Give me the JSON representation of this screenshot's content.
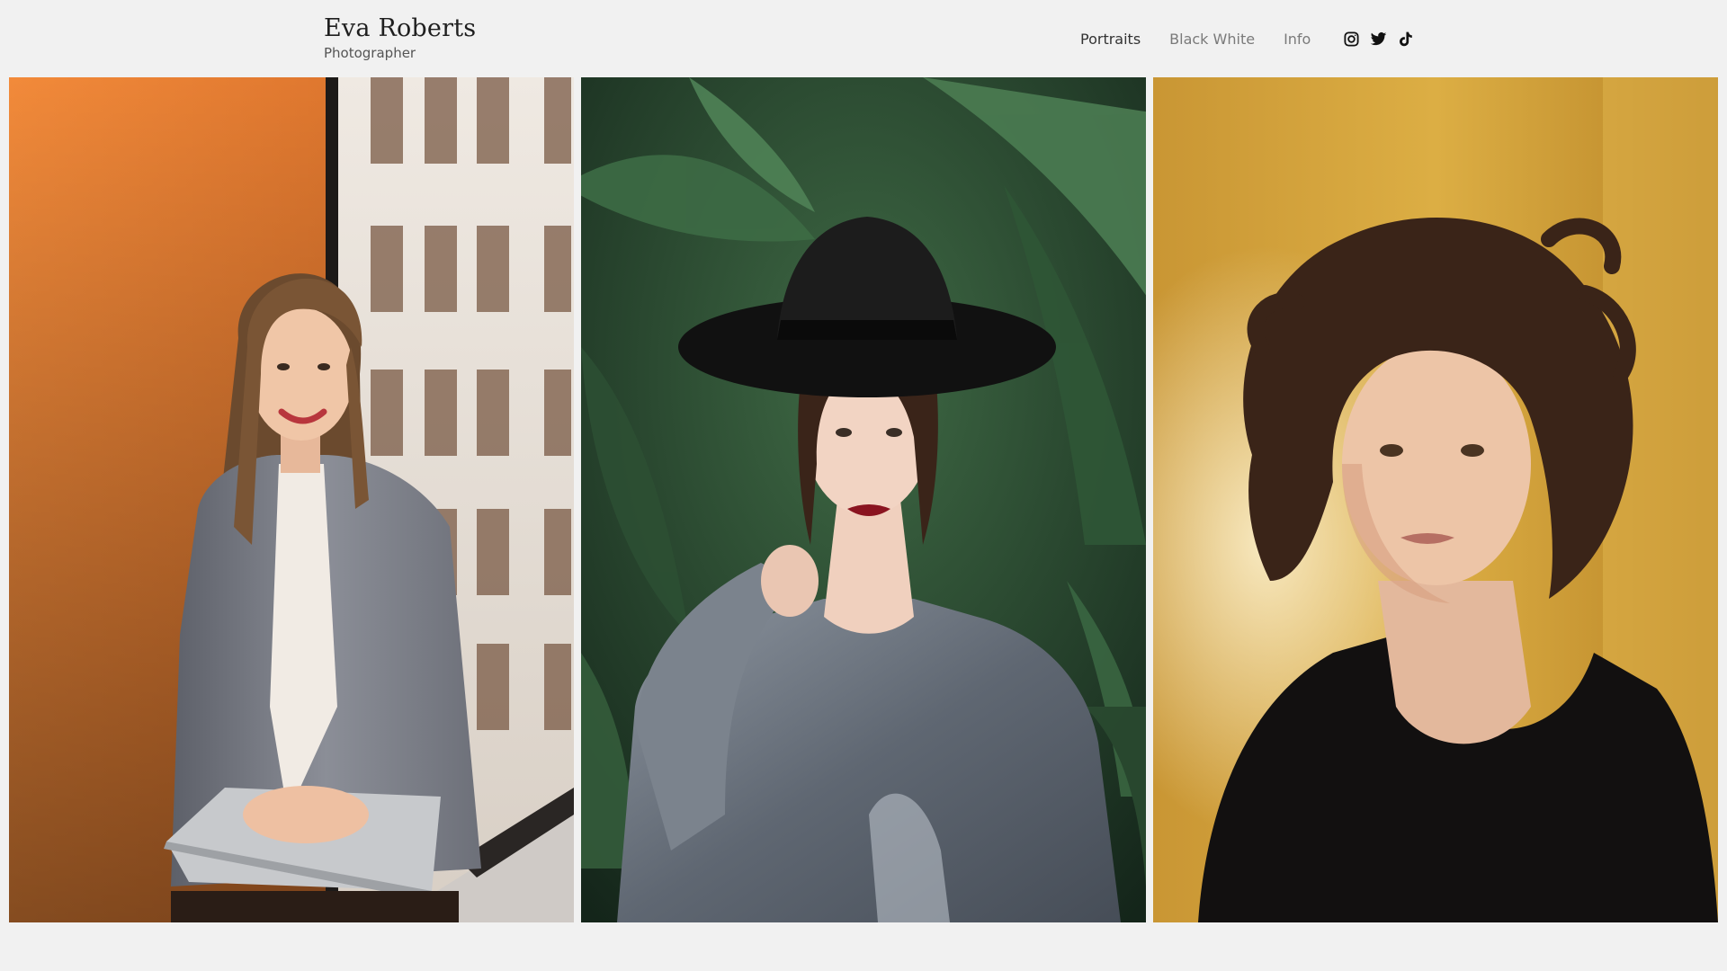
{
  "brand": {
    "name": "Eva Roberts",
    "subtitle": "Photographer"
  },
  "nav": {
    "items": [
      {
        "label": "Portraits",
        "active": true
      },
      {
        "label": "Black White",
        "active": false
      },
      {
        "label": "Info",
        "active": false
      }
    ],
    "social": [
      {
        "icon": "instagram-icon"
      },
      {
        "icon": "twitter-icon"
      },
      {
        "icon": "tiktok-icon"
      }
    ]
  },
  "gallery": {
    "photos": [
      {
        "subject": "portrait-woman-grey-blazer",
        "background_color": "#e0782f"
      },
      {
        "subject": "portrait-woman-black-hat",
        "background_color": "#2e4a30"
      },
      {
        "subject": "portrait-woman-curly-hair",
        "background_color": "#cf9f33"
      }
    ]
  },
  "colors": {
    "page_background": "#f1f1f1",
    "text_primary": "#1f1f1f",
    "text_muted": "#7a7a7a"
  }
}
